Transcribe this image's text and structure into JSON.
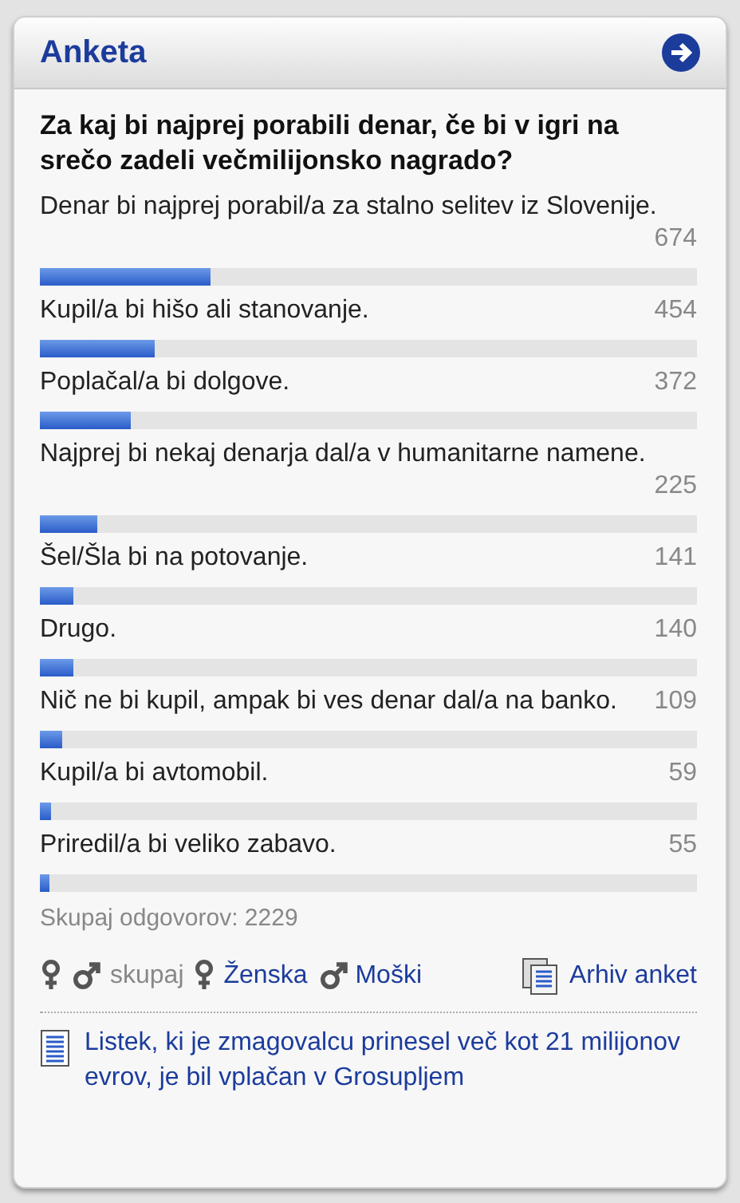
{
  "header": {
    "title": "Anketa"
  },
  "question": "Za kaj bi najprej porabili denar, če bi v igri na srečo zadeli večmilijonsko nagrado?",
  "answers": [
    {
      "label": "Denar bi najprej porabil/a za stalno selitev iz Slovenije.",
      "count": "674",
      "level": 0.26
    },
    {
      "label": "Kupil/a bi hišo ali stanovanje.",
      "count": "454",
      "level": 0.175
    },
    {
      "label": "Poplačal/a bi dolgove.",
      "count": "372",
      "level": 0.138
    },
    {
      "label": "Najprej bi nekaj denarja dal/a v humanitarne namene.",
      "count": "225",
      "level": 0.087
    },
    {
      "label": "Šel/Šla bi na potovanje.",
      "count": "141",
      "level": 0.052
    },
    {
      "label": "Drugo.",
      "count": "140",
      "level": 0.052
    },
    {
      "label": "Nič ne bi kupil, ampak bi ves denar dal/a na banko.",
      "count": "109",
      "level": 0.034
    },
    {
      "label": "Kupil/a bi avtomobil.",
      "count": "59",
      "level": 0.016
    },
    {
      "label": "Priredil/a bi veliko zabavo.",
      "count": "55",
      "level": 0.015
    }
  ],
  "total": "Skupaj odgovorov: 2229",
  "filters": [
    {
      "kind": "both",
      "label": "skupaj",
      "selected": true
    },
    {
      "kind": "female",
      "label": "Ženska",
      "selected": false
    },
    {
      "kind": "male",
      "label": "Moški",
      "selected": false
    }
  ],
  "archive_link": "Arhiv anket",
  "related_article": "Listek, ki je zmagovalcu prinesel več kot 21 milijonov evrov, je bil vplačan v Grosupljem"
}
